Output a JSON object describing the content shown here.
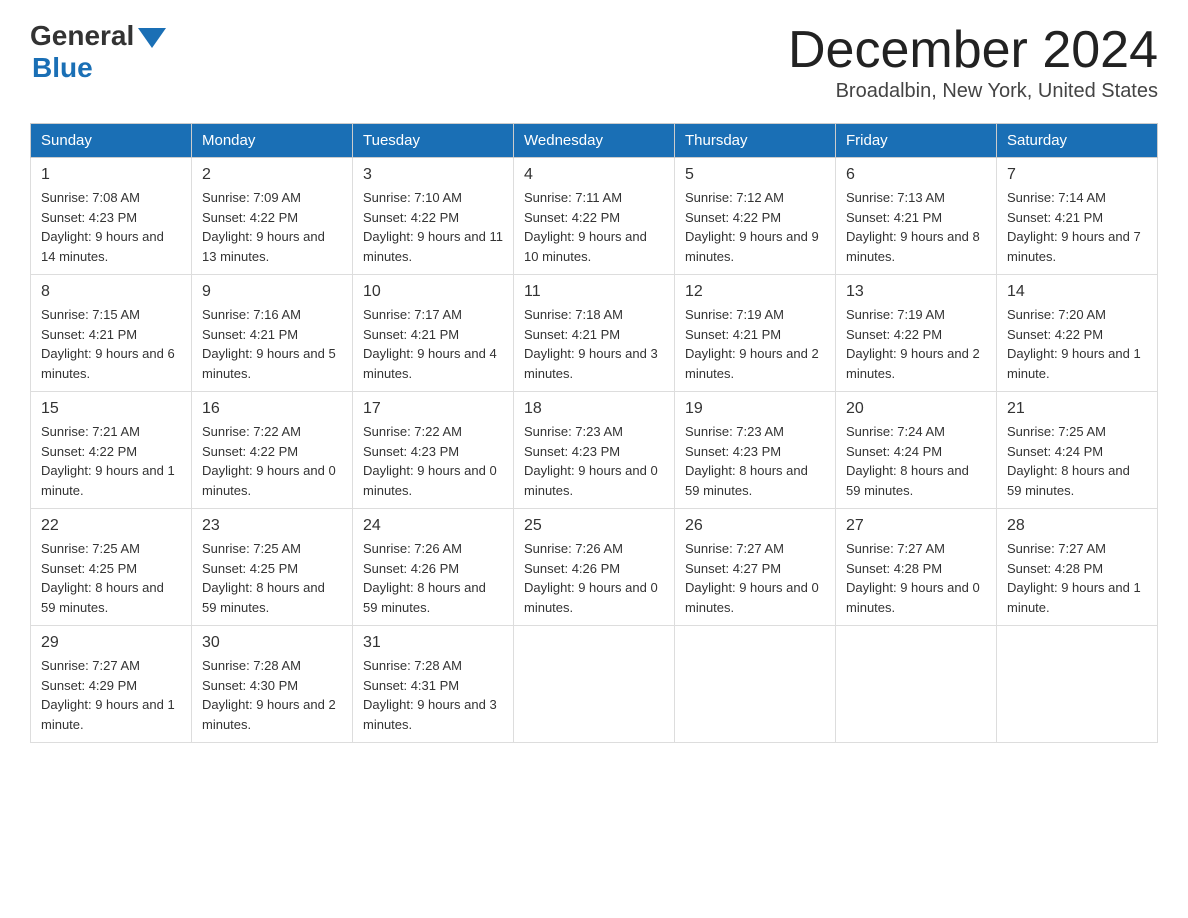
{
  "header": {
    "logo_general": "General",
    "logo_blue": "Blue",
    "month_title": "December 2024",
    "location": "Broadalbin, New York, United States"
  },
  "days_of_week": [
    "Sunday",
    "Monday",
    "Tuesday",
    "Wednesday",
    "Thursday",
    "Friday",
    "Saturday"
  ],
  "weeks": [
    [
      {
        "day": "1",
        "sunrise": "7:08 AM",
        "sunset": "4:23 PM",
        "daylight": "9 hours and 14 minutes."
      },
      {
        "day": "2",
        "sunrise": "7:09 AM",
        "sunset": "4:22 PM",
        "daylight": "9 hours and 13 minutes."
      },
      {
        "day": "3",
        "sunrise": "7:10 AM",
        "sunset": "4:22 PM",
        "daylight": "9 hours and 11 minutes."
      },
      {
        "day": "4",
        "sunrise": "7:11 AM",
        "sunset": "4:22 PM",
        "daylight": "9 hours and 10 minutes."
      },
      {
        "day": "5",
        "sunrise": "7:12 AM",
        "sunset": "4:22 PM",
        "daylight": "9 hours and 9 minutes."
      },
      {
        "day": "6",
        "sunrise": "7:13 AM",
        "sunset": "4:21 PM",
        "daylight": "9 hours and 8 minutes."
      },
      {
        "day": "7",
        "sunrise": "7:14 AM",
        "sunset": "4:21 PM",
        "daylight": "9 hours and 7 minutes."
      }
    ],
    [
      {
        "day": "8",
        "sunrise": "7:15 AM",
        "sunset": "4:21 PM",
        "daylight": "9 hours and 6 minutes."
      },
      {
        "day": "9",
        "sunrise": "7:16 AM",
        "sunset": "4:21 PM",
        "daylight": "9 hours and 5 minutes."
      },
      {
        "day": "10",
        "sunrise": "7:17 AM",
        "sunset": "4:21 PM",
        "daylight": "9 hours and 4 minutes."
      },
      {
        "day": "11",
        "sunrise": "7:18 AM",
        "sunset": "4:21 PM",
        "daylight": "9 hours and 3 minutes."
      },
      {
        "day": "12",
        "sunrise": "7:19 AM",
        "sunset": "4:21 PM",
        "daylight": "9 hours and 2 minutes."
      },
      {
        "day": "13",
        "sunrise": "7:19 AM",
        "sunset": "4:22 PM",
        "daylight": "9 hours and 2 minutes."
      },
      {
        "day": "14",
        "sunrise": "7:20 AM",
        "sunset": "4:22 PM",
        "daylight": "9 hours and 1 minute."
      }
    ],
    [
      {
        "day": "15",
        "sunrise": "7:21 AM",
        "sunset": "4:22 PM",
        "daylight": "9 hours and 1 minute."
      },
      {
        "day": "16",
        "sunrise": "7:22 AM",
        "sunset": "4:22 PM",
        "daylight": "9 hours and 0 minutes."
      },
      {
        "day": "17",
        "sunrise": "7:22 AM",
        "sunset": "4:23 PM",
        "daylight": "9 hours and 0 minutes."
      },
      {
        "day": "18",
        "sunrise": "7:23 AM",
        "sunset": "4:23 PM",
        "daylight": "9 hours and 0 minutes."
      },
      {
        "day": "19",
        "sunrise": "7:23 AM",
        "sunset": "4:23 PM",
        "daylight": "8 hours and 59 minutes."
      },
      {
        "day": "20",
        "sunrise": "7:24 AM",
        "sunset": "4:24 PM",
        "daylight": "8 hours and 59 minutes."
      },
      {
        "day": "21",
        "sunrise": "7:25 AM",
        "sunset": "4:24 PM",
        "daylight": "8 hours and 59 minutes."
      }
    ],
    [
      {
        "day": "22",
        "sunrise": "7:25 AM",
        "sunset": "4:25 PM",
        "daylight": "8 hours and 59 minutes."
      },
      {
        "day": "23",
        "sunrise": "7:25 AM",
        "sunset": "4:25 PM",
        "daylight": "8 hours and 59 minutes."
      },
      {
        "day": "24",
        "sunrise": "7:26 AM",
        "sunset": "4:26 PM",
        "daylight": "8 hours and 59 minutes."
      },
      {
        "day": "25",
        "sunrise": "7:26 AM",
        "sunset": "4:26 PM",
        "daylight": "9 hours and 0 minutes."
      },
      {
        "day": "26",
        "sunrise": "7:27 AM",
        "sunset": "4:27 PM",
        "daylight": "9 hours and 0 minutes."
      },
      {
        "day": "27",
        "sunrise": "7:27 AM",
        "sunset": "4:28 PM",
        "daylight": "9 hours and 0 minutes."
      },
      {
        "day": "28",
        "sunrise": "7:27 AM",
        "sunset": "4:28 PM",
        "daylight": "9 hours and 1 minute."
      }
    ],
    [
      {
        "day": "29",
        "sunrise": "7:27 AM",
        "sunset": "4:29 PM",
        "daylight": "9 hours and 1 minute."
      },
      {
        "day": "30",
        "sunrise": "7:28 AM",
        "sunset": "4:30 PM",
        "daylight": "9 hours and 2 minutes."
      },
      {
        "day": "31",
        "sunrise": "7:28 AM",
        "sunset": "4:31 PM",
        "daylight": "9 hours and 3 minutes."
      },
      null,
      null,
      null,
      null
    ]
  ]
}
